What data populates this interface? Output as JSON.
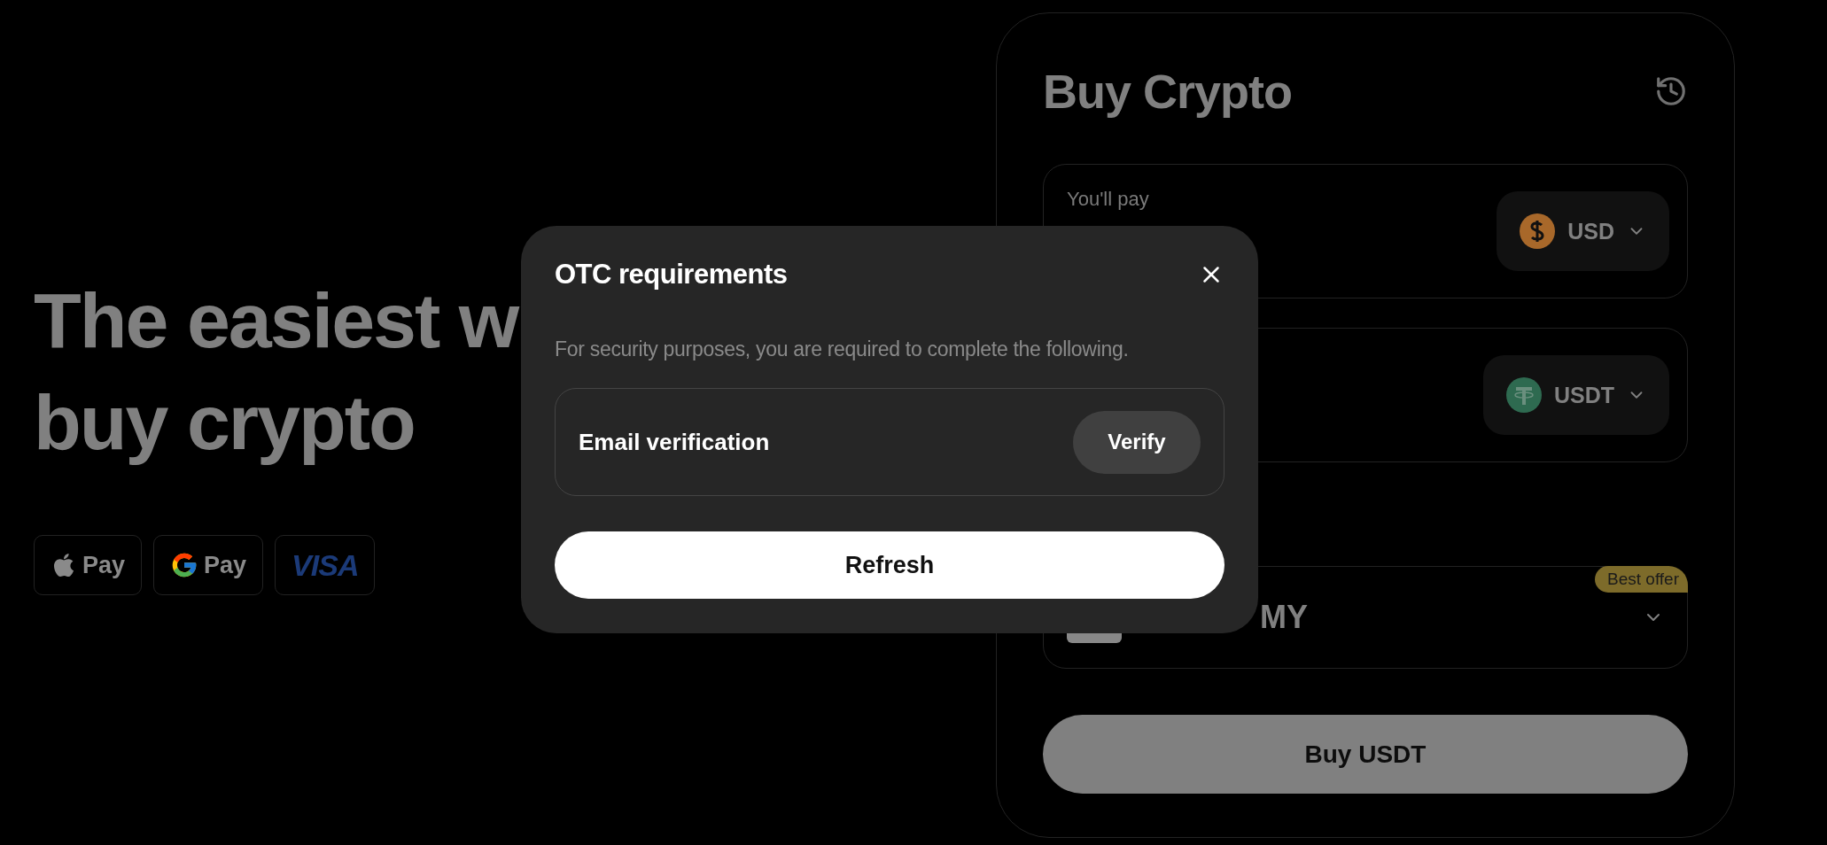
{
  "hero": {
    "title_lines": [
      "The easiest w",
      "buy crypto"
    ],
    "payment_methods": [
      {
        "kind": "apple",
        "label": "Pay"
      },
      {
        "kind": "google",
        "label": "Pay"
      },
      {
        "kind": "visa",
        "label": "VISA"
      }
    ]
  },
  "buy_card": {
    "title": "Buy Crypto",
    "pay": {
      "label": "You'll pay",
      "currency": "USD",
      "kind": "dollar"
    },
    "receive": {
      "currency": "USDT",
      "kind": "tether"
    },
    "provider": {
      "name": "MY",
      "badge": "Best offer"
    },
    "button": "Buy USDT"
  },
  "modal": {
    "title": "OTC requirements",
    "description": "For security purposes, you are required to complete the following.",
    "requirements": [
      {
        "label": "Email verification",
        "action": "Verify"
      }
    ],
    "button": "Refresh"
  }
}
